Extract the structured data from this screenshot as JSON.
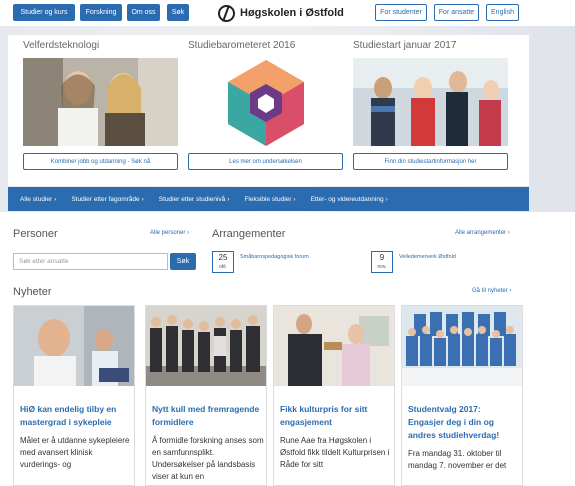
{
  "header": {
    "nav": [
      "Studier og kurs",
      "Forskning",
      "Om oss",
      "Søk"
    ],
    "logo_text": "Høgskolen i Østfold",
    "audience_links": [
      "For studenter",
      "For ansatte",
      "English"
    ]
  },
  "hero": {
    "features": [
      {
        "title": "Velferdsteknologi",
        "button": "Kombiner jobb og utdanning - Søk nå"
      },
      {
        "title": "Studiebarometeret 2016",
        "button": "Les mer om undersøkelsen"
      },
      {
        "title": "Studiestart januar 2017",
        "button": "Finn din studiestartinformasjon her"
      }
    ],
    "categories": [
      "Alle studier",
      "Studier etter fagområde",
      "Studier etter studienivå",
      "Fleksible studier",
      "Etter- og videreutdanning"
    ]
  },
  "persons": {
    "title": "Personer",
    "link": "Alle personer ›",
    "search_placeholder": "Søk etter ansatte",
    "search_button": "Søk"
  },
  "events": {
    "title": "Arrangementer",
    "link": "Alle arrangementer ›",
    "items": [
      {
        "day": "25",
        "month": "okt.",
        "title": "Småbarnspedagogisk forum"
      },
      {
        "day": "9",
        "month": "nov.",
        "title": "Veiledemerverk Østfold"
      }
    ]
  },
  "news": {
    "title": "Nyheter",
    "link": "Gå til nyheter ›",
    "items": [
      {
        "title": "HiØ kan endelig tilby en mastergrad i sykepleie",
        "body": "Målet er å utdanne sykepleiere med avansert klinisk vurderings- og"
      },
      {
        "title": "Nytt kull med fremragende formidlere",
        "body": "Å formidle forskning anses som en samfunnsplikt. Undersøkelser på landsbasis viser at kun en"
      },
      {
        "title": "Fikk kulturpris for sitt engasjement",
        "body": "Rune Aae fra Høgskolen i Østfold fikk tildelt Kulturprisen i Råde for sitt"
      },
      {
        "title": "Studentvalg 2017: Engasjer deg i din og andres studiehverdag!",
        "body": "Fra mandag 31. oktober til mandag 7. november er det"
      }
    ]
  },
  "colors": {
    "accent": "#2b6cb0"
  }
}
